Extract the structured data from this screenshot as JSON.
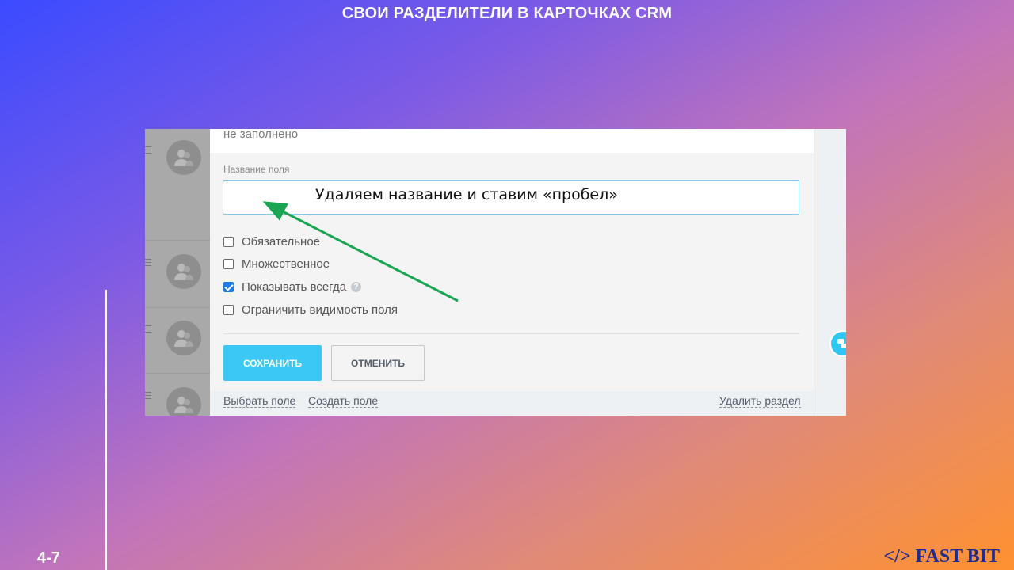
{
  "slide": {
    "title": "СВОИ РАЗДЕЛИТЕЛИ В КАРТОЧКАХ CRM",
    "number": "4-7",
    "brand": "</> FAST BIT"
  },
  "form": {
    "previous_value": "не заполнено",
    "field_name_label": "Название поля",
    "field_name_value": "",
    "callout": "Удаляем название и ставим «пробел»",
    "options": [
      {
        "label": "Обязательное",
        "checked": false
      },
      {
        "label": "Множественное",
        "checked": false
      },
      {
        "label": "Показывать всегда",
        "checked": true
      },
      {
        "label": "Ограничить видимость поля",
        "checked": false
      }
    ],
    "save_label": "СОХРАНИТЬ",
    "cancel_label": "ОТМЕНИТЬ",
    "links": {
      "select_field": "Выбрать поле",
      "create_field": "Создать поле",
      "delete_section": "Удалить раздел"
    }
  },
  "colors": {
    "accent": "#3bc8f5",
    "arrow": "#1aa552",
    "checkbox_checked": "#1a7ce0",
    "brand": "#1f2d8f"
  },
  "icons": {
    "avatar": "user-group-icon",
    "help": "question-icon",
    "chat": "chat-icon"
  }
}
